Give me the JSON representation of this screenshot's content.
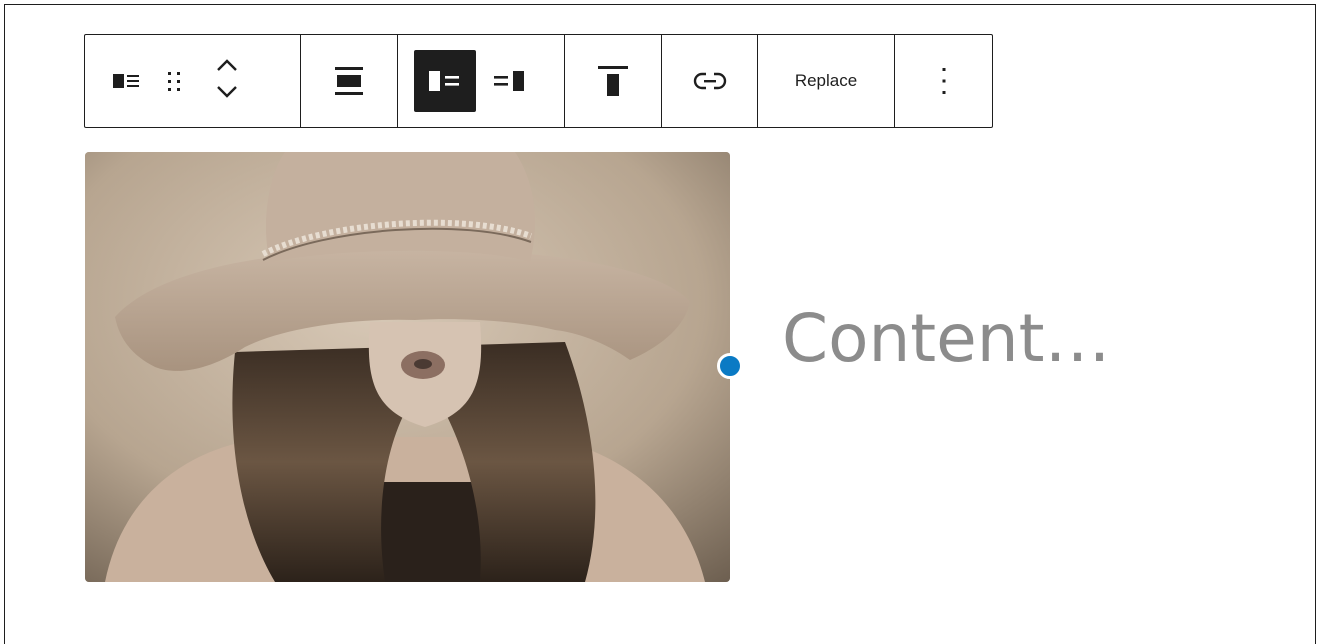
{
  "toolbar": {
    "icons": {
      "block_type": "media-text-icon",
      "drag": "drag-handle-icon",
      "move_up": "chevron-up-icon",
      "move_down": "chevron-down-icon",
      "align": "align-wide-icon",
      "media_left": "media-left-icon",
      "media_right": "media-right-icon",
      "vertical_align": "align-top-icon",
      "link": "link-icon",
      "more": "more-vertical-icon"
    },
    "replace_label": "Replace",
    "active_position": "media-left"
  },
  "media": {
    "description": "sepia photo of woman in wide-brim hat"
  },
  "content": {
    "placeholder": "Content…"
  },
  "colors": {
    "accent": "#0a7ac4",
    "text": "#1e1e1e",
    "placeholder": "#8c8c8c"
  }
}
